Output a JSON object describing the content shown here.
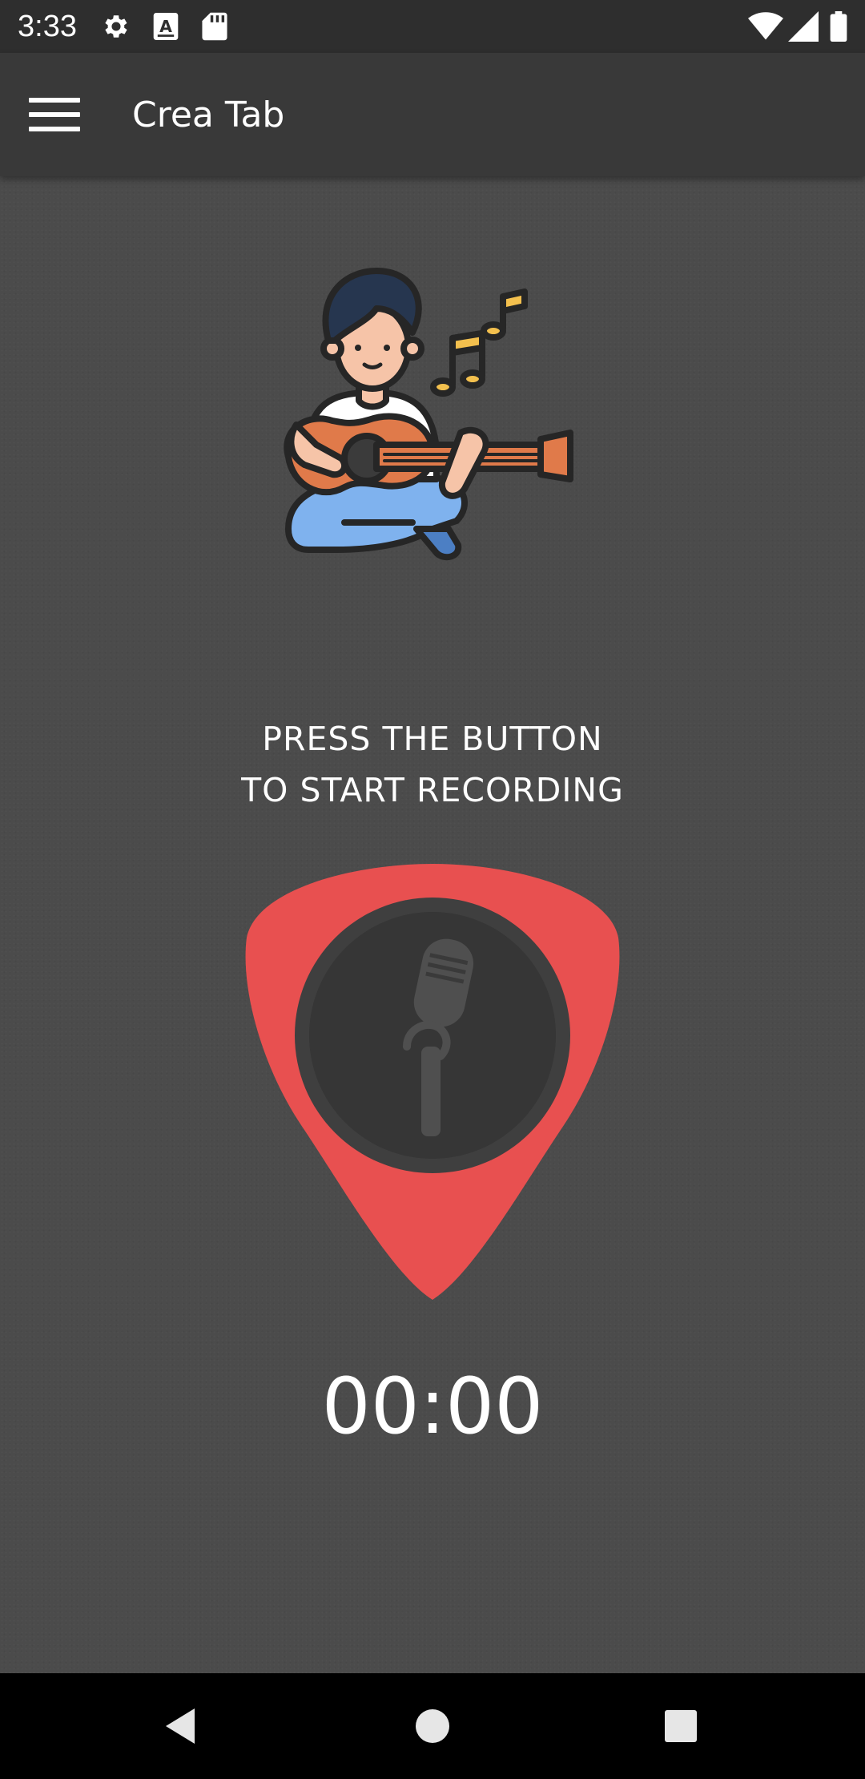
{
  "status_bar": {
    "time": "3:33",
    "icons": [
      "gear-icon",
      "a-keyboard-icon",
      "sd-card-icon",
      "wifi-icon",
      "signal-icon",
      "battery-icon"
    ]
  },
  "app_bar": {
    "title": "Crea Tab",
    "menu_icon": "hamburger-menu-icon"
  },
  "main": {
    "illustration": "guitar-player-icon",
    "instruction_line1": "PRESS THE BUTTON",
    "instruction_line2": "TO START RECORDING",
    "record_button_icon": "microphone-icon",
    "timer": "00:00"
  },
  "colors": {
    "pick_red": "#e85050",
    "mic_circle": "#3b3b3b",
    "content_bg": "#4b4b4b",
    "app_bar_bg": "#393939"
  },
  "nav_bar": {
    "icons": [
      "back-icon",
      "home-icon",
      "recents-icon"
    ]
  }
}
